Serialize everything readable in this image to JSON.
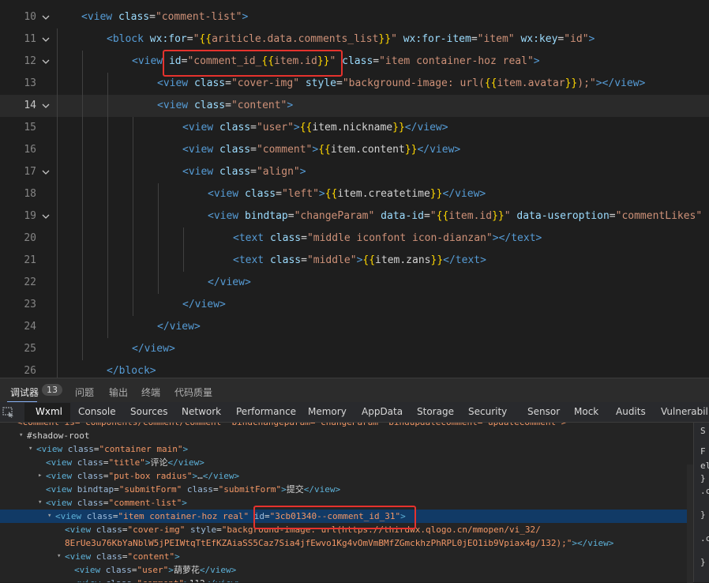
{
  "editor": {
    "current_line": "14",
    "lines": [
      {
        "num": "10",
        "fold": true,
        "indent": 0,
        "tokens": [
          [
            "t",
            "<view "
          ],
          [
            "a",
            "class"
          ],
          [
            "p",
            "="
          ],
          [
            "s",
            "\"comment-list\""
          ],
          [
            "t",
            ">"
          ]
        ]
      },
      {
        "num": "11",
        "fold": true,
        "indent": 1,
        "tokens": [
          [
            "t",
            "<block "
          ],
          [
            "a",
            "wx:for"
          ],
          [
            "p",
            "="
          ],
          [
            "s",
            "\""
          ],
          [
            "m",
            "{{"
          ],
          [
            "s",
            "ariticle.data.comments_list"
          ],
          [
            "m",
            "}}"
          ],
          [
            "s",
            "\""
          ],
          [
            "p",
            " "
          ],
          [
            "a",
            "wx:for-item"
          ],
          [
            "p",
            "="
          ],
          [
            "s",
            "\"item\""
          ],
          [
            "p",
            " "
          ],
          [
            "a",
            "wx:key"
          ],
          [
            "p",
            "="
          ],
          [
            "s",
            "\"id\""
          ],
          [
            "t",
            ">"
          ]
        ]
      },
      {
        "num": "12",
        "fold": true,
        "indent": 2,
        "tokens": [
          [
            "t",
            "<view "
          ],
          [
            "a",
            "id"
          ],
          [
            "p",
            "="
          ],
          [
            "s",
            "\"comment_id_"
          ],
          [
            "m",
            "{{"
          ],
          [
            "s",
            "item.id"
          ],
          [
            "m",
            "}}"
          ],
          [
            "s",
            "\""
          ],
          [
            "p",
            " "
          ],
          [
            "a",
            "class"
          ],
          [
            "p",
            "="
          ],
          [
            "s",
            "\"item container-hoz real\""
          ],
          [
            "t",
            ">"
          ]
        ]
      },
      {
        "num": "13",
        "fold": false,
        "indent": 3,
        "tokens": [
          [
            "t",
            "<view "
          ],
          [
            "a",
            "class"
          ],
          [
            "p",
            "="
          ],
          [
            "s",
            "\"cover-img\""
          ],
          [
            "p",
            " "
          ],
          [
            "a",
            "style"
          ],
          [
            "p",
            "="
          ],
          [
            "s",
            "\"background-image: url("
          ],
          [
            "m",
            "{{"
          ],
          [
            "s",
            "item.avatar"
          ],
          [
            "m",
            "}}"
          ],
          [
            "s",
            ");\""
          ],
          [
            "t",
            "></view>"
          ]
        ]
      },
      {
        "num": "14",
        "fold": true,
        "indent": 3,
        "tokens": [
          [
            "t",
            "<view "
          ],
          [
            "a",
            "class"
          ],
          [
            "p",
            "="
          ],
          [
            "s",
            "\"content\""
          ],
          [
            "t",
            ">"
          ]
        ]
      },
      {
        "num": "15",
        "fold": false,
        "indent": 4,
        "tokens": [
          [
            "t",
            "<view "
          ],
          [
            "a",
            "class"
          ],
          [
            "p",
            "="
          ],
          [
            "s",
            "\"user\""
          ],
          [
            "t",
            ">"
          ],
          [
            "m",
            "{{"
          ],
          [
            "p",
            "item.nickname"
          ],
          [
            "m",
            "}}"
          ],
          [
            "t",
            "</view>"
          ]
        ]
      },
      {
        "num": "16",
        "fold": false,
        "indent": 4,
        "tokens": [
          [
            "t",
            "<view "
          ],
          [
            "a",
            "class"
          ],
          [
            "p",
            "="
          ],
          [
            "s",
            "\"comment\""
          ],
          [
            "t",
            ">"
          ],
          [
            "m",
            "{{"
          ],
          [
            "p",
            "item.content"
          ],
          [
            "m",
            "}}"
          ],
          [
            "t",
            "</view>"
          ]
        ]
      },
      {
        "num": "17",
        "fold": true,
        "indent": 4,
        "tokens": [
          [
            "t",
            "<view "
          ],
          [
            "a",
            "class"
          ],
          [
            "p",
            "="
          ],
          [
            "s",
            "\"align\""
          ],
          [
            "t",
            ">"
          ]
        ]
      },
      {
        "num": "18",
        "fold": false,
        "indent": 5,
        "tokens": [
          [
            "t",
            "<view "
          ],
          [
            "a",
            "class"
          ],
          [
            "p",
            "="
          ],
          [
            "s",
            "\"left\""
          ],
          [
            "t",
            ">"
          ],
          [
            "m",
            "{{"
          ],
          [
            "p",
            "item.createtime"
          ],
          [
            "m",
            "}}"
          ],
          [
            "t",
            "</view>"
          ]
        ]
      },
      {
        "num": "19",
        "fold": true,
        "indent": 5,
        "tokens": [
          [
            "t",
            "<view "
          ],
          [
            "a",
            "bindtap"
          ],
          [
            "p",
            "="
          ],
          [
            "s",
            "\"changeParam\""
          ],
          [
            "p",
            " "
          ],
          [
            "a",
            "data-id"
          ],
          [
            "p",
            "="
          ],
          [
            "s",
            "\""
          ],
          [
            "m",
            "{{"
          ],
          [
            "s",
            "item.id"
          ],
          [
            "m",
            "}}"
          ],
          [
            "s",
            "\""
          ],
          [
            "p",
            " "
          ],
          [
            "a",
            "data-useroption"
          ],
          [
            "p",
            "="
          ],
          [
            "s",
            "\"commentLikes\""
          ]
        ]
      },
      {
        "num": "20",
        "fold": false,
        "indent": 6,
        "tokens": [
          [
            "t",
            "<text "
          ],
          [
            "a",
            "class"
          ],
          [
            "p",
            "="
          ],
          [
            "s",
            "\"middle iconfont icon-dianzan\""
          ],
          [
            "t",
            "></text>"
          ]
        ]
      },
      {
        "num": "21",
        "fold": false,
        "indent": 6,
        "tokens": [
          [
            "t",
            "<text "
          ],
          [
            "a",
            "class"
          ],
          [
            "p",
            "="
          ],
          [
            "s",
            "\"middle\""
          ],
          [
            "t",
            ">"
          ],
          [
            "m",
            "{{"
          ],
          [
            "p",
            "item.zans"
          ],
          [
            "m",
            "}}"
          ],
          [
            "t",
            "</text>"
          ]
        ]
      },
      {
        "num": "22",
        "fold": false,
        "indent": 5,
        "tokens": [
          [
            "t",
            "</view>"
          ]
        ]
      },
      {
        "num": "23",
        "fold": false,
        "indent": 4,
        "tokens": [
          [
            "t",
            "</view>"
          ]
        ]
      },
      {
        "num": "24",
        "fold": false,
        "indent": 3,
        "tokens": [
          [
            "t",
            "</view>"
          ]
        ]
      },
      {
        "num": "25",
        "fold": false,
        "indent": 2,
        "tokens": [
          [
            "t",
            "</view>"
          ]
        ]
      },
      {
        "num": "26",
        "fold": false,
        "indent": 1,
        "tokens": [
          [
            "t",
            "</block>"
          ]
        ]
      }
    ]
  },
  "panel_tabs": {
    "debugger": "调试器",
    "debugger_count": "13",
    "problems": "问题",
    "output": "输出",
    "terminal": "终端",
    "code_quality": "代码质量"
  },
  "devtools_tabs": [
    "Wxml",
    "Console",
    "Sources",
    "Network",
    "Performance",
    "Memory",
    "AppData",
    "Storage",
    "Security",
    "Sensor",
    "Mock",
    "Audits",
    "Vulnerability"
  ],
  "active_devtools_tab": "Wxml",
  "dom_tree": [
    {
      "indent": 0,
      "tri": "",
      "tokens": [
        [
          "ds",
          "<comment is=\"components/comment/comment\" bindchangeparam=\"changeParam\" bindupdatecomment=\"updateComment\">"
        ]
      ]
    },
    {
      "indent": 1,
      "tri": "▾",
      "tokens": [
        [
          "dp",
          "#shadow-root"
        ]
      ]
    },
    {
      "indent": 2,
      "tri": "▾",
      "tokens": [
        [
          "dt",
          "<view "
        ],
        [
          "da",
          "class"
        ],
        [
          "dp",
          "="
        ],
        [
          "ds",
          "\"container main\""
        ],
        [
          "dt",
          ">"
        ]
      ]
    },
    {
      "indent": 3,
      "tri": "",
      "tokens": [
        [
          "dt",
          "<view "
        ],
        [
          "da",
          "class"
        ],
        [
          "dp",
          "="
        ],
        [
          "ds",
          "\"title\""
        ],
        [
          "dt",
          ">"
        ],
        [
          "dp",
          "评论"
        ],
        [
          "dt",
          "</view>"
        ]
      ]
    },
    {
      "indent": 3,
      "tri": "▸",
      "tokens": [
        [
          "dt",
          "<view "
        ],
        [
          "da",
          "class"
        ],
        [
          "dp",
          "="
        ],
        [
          "ds",
          "\"put-box radius\""
        ],
        [
          "dt",
          ">"
        ],
        [
          "dp",
          "…"
        ],
        [
          "dt",
          "</view>"
        ]
      ]
    },
    {
      "indent": 3,
      "tri": "",
      "tokens": [
        [
          "dt",
          "<view "
        ],
        [
          "da",
          "bindtap"
        ],
        [
          "dp",
          "="
        ],
        [
          "ds",
          "\"submitForm\""
        ],
        [
          "dp",
          " "
        ],
        [
          "da",
          "class"
        ],
        [
          "dp",
          "="
        ],
        [
          "ds",
          "\"submitForm\""
        ],
        [
          "dt",
          ">"
        ],
        [
          "dp",
          "提交"
        ],
        [
          "dt",
          "</view>"
        ]
      ]
    },
    {
      "indent": 3,
      "tri": "▾",
      "tokens": [
        [
          "dt",
          "<view "
        ],
        [
          "da",
          "class"
        ],
        [
          "dp",
          "="
        ],
        [
          "ds",
          "\"comment-list\""
        ],
        [
          "dt",
          ">"
        ]
      ]
    },
    {
      "indent": 4,
      "tri": "▾",
      "sel": true,
      "tokens": [
        [
          "dt",
          "<view "
        ],
        [
          "da",
          "class"
        ],
        [
          "dp",
          "="
        ],
        [
          "ds",
          "\"item container-hoz real\""
        ],
        [
          "dp",
          " "
        ],
        [
          "da",
          "id"
        ],
        [
          "dp",
          "="
        ],
        [
          "ds",
          "\"3cb01340--comment_id_31\""
        ],
        [
          "dt",
          ">"
        ]
      ]
    },
    {
      "indent": 5,
      "tri": "",
      "tokens": [
        [
          "dt",
          "<view "
        ],
        [
          "da",
          "class"
        ],
        [
          "dp",
          "="
        ],
        [
          "ds",
          "\"cover-img\""
        ],
        [
          "dp",
          " "
        ],
        [
          "da",
          "style"
        ],
        [
          "dp",
          "="
        ],
        [
          "ds",
          "\"background-image: url(https://thirdwx.qlogo.cn/mmopen/vi_32/"
        ]
      ]
    },
    {
      "indent": 5,
      "tri": "",
      "tokens": [
        [
          "ds",
          "8ErUe3u76KbYaNblW5jPEIWtqTtEfKZAiaSS5Caz7Sia4jfEwvo1Kg4vOmVmBMfZGmckhzPhRPL0jEO1ib9Vpiax4g/132);\""
        ],
        [
          "dt",
          "></view>"
        ]
      ]
    },
    {
      "indent": 5,
      "tri": "▾",
      "tokens": [
        [
          "dt",
          "<view "
        ],
        [
          "da",
          "class"
        ],
        [
          "dp",
          "="
        ],
        [
          "ds",
          "\"content\""
        ],
        [
          "dt",
          ">"
        ]
      ]
    },
    {
      "indent": 6,
      "tri": "",
      "tokens": [
        [
          "dt",
          "<view "
        ],
        [
          "da",
          "class"
        ],
        [
          "dp",
          "="
        ],
        [
          "ds",
          "\"user\""
        ],
        [
          "dt",
          ">"
        ],
        [
          "dp",
          "葫萝花"
        ],
        [
          "dt",
          "</view>"
        ]
      ]
    },
    {
      "indent": 6,
      "tri": "",
      "tokens": [
        [
          "dt",
          "<view "
        ],
        [
          "da",
          "class"
        ],
        [
          "dp",
          "="
        ],
        [
          "ds",
          "\"comment\""
        ],
        [
          "dt",
          ">"
        ],
        [
          "dp",
          "112"
        ],
        [
          "dt",
          "</view>"
        ]
      ]
    }
  ],
  "side_pane": {
    "labels": [
      "S",
      "F",
      "el",
      "}",
      ".c",
      "}",
      ".c",
      "}"
    ]
  }
}
